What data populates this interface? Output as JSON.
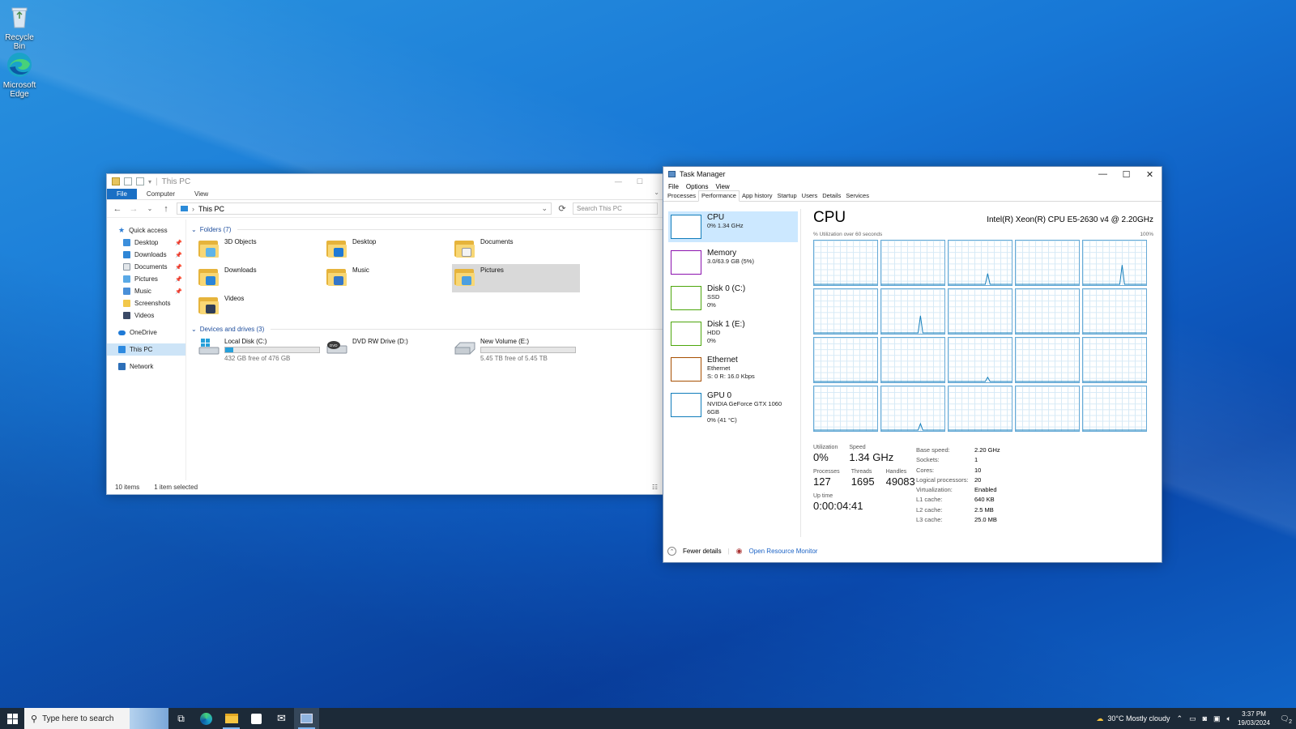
{
  "desktop": {
    "icons": [
      {
        "label": "Recycle Bin",
        "icon": "recycle-bin-icon"
      },
      {
        "label": "Microsoft Edge",
        "icon": "edge-icon"
      }
    ]
  },
  "explorer": {
    "title": "This PC",
    "ribbon_tabs": [
      "File",
      "Computer",
      "View"
    ],
    "address": "This PC",
    "search_placeholder": "Search This PC",
    "nav": {
      "quick_access": "Quick access",
      "items": [
        "Desktop",
        "Downloads",
        "Documents",
        "Pictures",
        "Music",
        "Screenshots",
        "Videos"
      ],
      "onedrive": "OneDrive",
      "this_pc": "This PC",
      "network": "Network"
    },
    "folders_header": "Folders (7)",
    "folders": [
      "3D Objects",
      "Desktop",
      "Documents",
      "Downloads",
      "Music",
      "Pictures",
      "Videos"
    ],
    "drives_header": "Devices and drives (3)",
    "drives": [
      {
        "name": "Local Disk (C:)",
        "free": "432 GB free of 476 GB",
        "used_fraction": 0.09
      },
      {
        "name": "DVD RW Drive (D:)"
      },
      {
        "name": "New Volume (E:)",
        "free": "5.45 TB free of 5.45 TB",
        "used_fraction": 0.0
      }
    ],
    "status": {
      "items": "10 items",
      "selected": "1 item selected"
    }
  },
  "taskmgr": {
    "title": "Task Manager",
    "menu": [
      "File",
      "Options",
      "View"
    ],
    "tabs": [
      "Processes",
      "Performance",
      "App history",
      "Startup",
      "Users",
      "Details",
      "Services"
    ],
    "resources": [
      {
        "name": "CPU",
        "sub1": "0% 1.34 GHz",
        "sub2": "",
        "sub3": "",
        "color": "#117dbb"
      },
      {
        "name": "Memory",
        "sub1": "3.0/63.9 GB (5%)",
        "sub2": "",
        "sub3": "",
        "color": "#8b12ae"
      },
      {
        "name": "Disk 0 (C:)",
        "sub1": "SSD",
        "sub2": "0%",
        "sub3": "",
        "color": "#4da60c"
      },
      {
        "name": "Disk 1 (E:)",
        "sub1": "HDD",
        "sub2": "0%",
        "sub3": "",
        "color": "#4da60c"
      },
      {
        "name": "Ethernet",
        "sub1": "Ethernet",
        "sub2": "S: 0 R: 16.0 Kbps",
        "sub3": "",
        "color": "#a74f01"
      },
      {
        "name": "GPU 0",
        "sub1": "NVIDIA GeForce GTX 1060 6GB",
        "sub2": "0% (41 °C)",
        "sub3": "",
        "color": "#117dbb"
      }
    ],
    "cpu": {
      "heading": "CPU",
      "model": "Intel(R) Xeon(R) CPU E5-2630 v4 @ 2.20GHz",
      "caption": "% Utilization over 60 seconds",
      "max_label": "100%",
      "utilization_label": "Utilization",
      "utilization": "0%",
      "speed_label": "Speed",
      "speed": "1.34 GHz",
      "processes_label": "Processes",
      "processes": "127",
      "threads_label": "Threads",
      "threads": "1695",
      "handles_label": "Handles",
      "handles": "49083",
      "uptime_label": "Up time",
      "uptime": "0:00:04:41",
      "specs": [
        {
          "k": "Base speed:",
          "v": "2.20 GHz"
        },
        {
          "k": "Sockets:",
          "v": "1"
        },
        {
          "k": "Cores:",
          "v": "10"
        },
        {
          "k": "Logical processors:",
          "v": "20"
        },
        {
          "k": "Virtualization:",
          "v": "Enabled"
        },
        {
          "k": "L1 cache:",
          "v": "640 KB"
        },
        {
          "k": "L2 cache:",
          "v": "2.5 MB"
        },
        {
          "k": "L3 cache:",
          "v": "25.0 MB"
        }
      ],
      "core_spikes": [
        0,
        0,
        0.25,
        0,
        0.45,
        0,
        0.4,
        0,
        0,
        0,
        0,
        0,
        0.1,
        0,
        0,
        0,
        0.15,
        0,
        0,
        0
      ]
    },
    "footer": {
      "fewer": "Fewer details",
      "monitor": "Open Resource Monitor"
    }
  },
  "taskbar": {
    "search_placeholder": "Type here to search",
    "weather": "30°C  Mostly cloudy",
    "time": "3:37 PM",
    "date": "19/03/2024",
    "notification_count": "2"
  }
}
